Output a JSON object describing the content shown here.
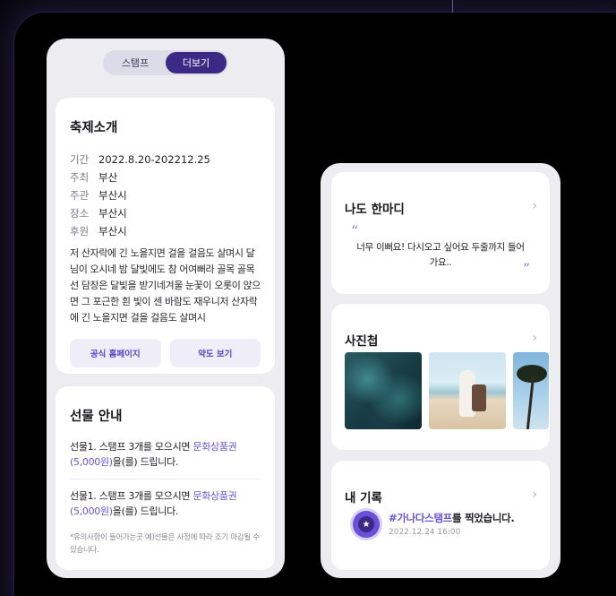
{
  "tabs": [
    {
      "label": "스탬프",
      "active": false
    },
    {
      "label": "더보기",
      "active": true
    }
  ],
  "festival": {
    "title": "축제소개",
    "info": [
      {
        "label": "기간",
        "value": "2022.8.20-202212.25"
      },
      {
        "label": "주최",
        "value": "부산"
      },
      {
        "label": "주관",
        "value": "부산시"
      },
      {
        "label": "장소",
        "value": "부산시"
      },
      {
        "label": "후원",
        "value": "부산시"
      }
    ],
    "description": "저 산자락에 긴 노을지면 걸을 걸음도 살며시 달님이 오시네 밤 달빛에도 참 어여뻐라 골목 골목 선 담장은 달빛을 받기네겨울 눈꽃이 오롯이 앉으면 그 포근한 흰 빛이 센 바람도 재우니저 산자락에 긴 노을지면 걸을 걸음도 살며시",
    "buttons": {
      "homepage": "공식 홈페이지",
      "map": "약도 보기"
    }
  },
  "gift": {
    "title": "선물 안내",
    "items": [
      {
        "prefix": "선물1. 스탬프 3개를 모으시면 ",
        "highlight": "문화상품권 (5,000원)",
        "suffix": "을(를) 드립니다."
      },
      {
        "prefix": "선물1. 스탬프 3개를 모으시면 ",
        "highlight": "문화상품권 (5,000원)",
        "suffix": "을(를) 드립니다."
      }
    ],
    "note": "*유의사항이 들어가는곳 예)선물은 사정에 따라 조기 마감될 수 있습니다."
  },
  "comment": {
    "title": "나도 한마디",
    "quote_open": "“",
    "quote_close": "”",
    "text": "너무 이뻐요! 다시오고 싶어요 두줄까지 들어가요..",
    "chevron": "›"
  },
  "photos": {
    "title": "사진첩",
    "chevron": "›",
    "images": [
      "coastal-rocks-aerial",
      "beach-woman-white-dress",
      "palm-tree-sky"
    ]
  },
  "record": {
    "title": "내 기록",
    "chevron": "›",
    "badge_icon": "star-icon",
    "badge_glyph": "★",
    "stamp_name": "#가나다스탬프",
    "stamp_suffix": "를 찍었습니다.",
    "date": "2022.12.24 16:00"
  },
  "colors": {
    "accent": "#3b2a85",
    "highlight": "#6a55d6",
    "frame": "#000000"
  }
}
